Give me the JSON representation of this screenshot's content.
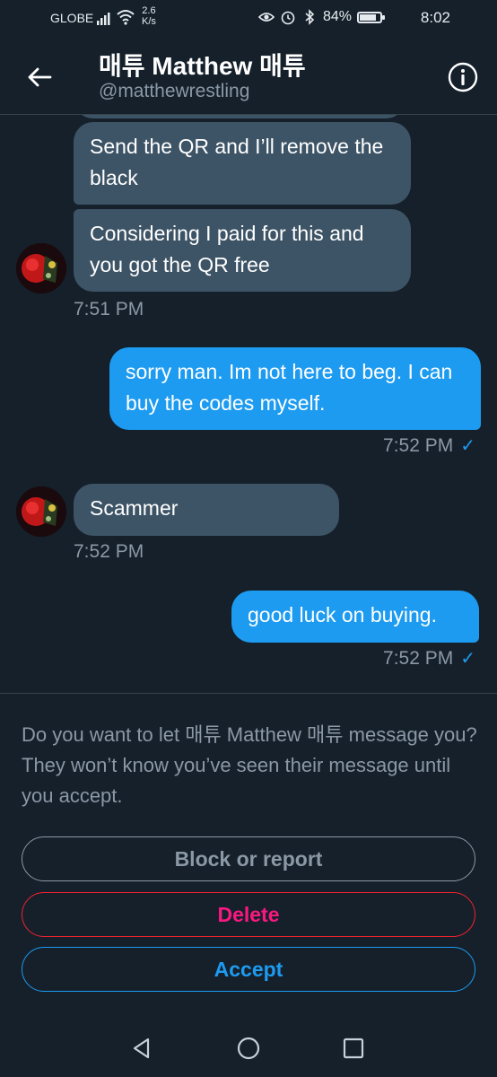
{
  "status_bar": {
    "carrier": "GLOBE",
    "net_speed_value": "2.6",
    "net_speed_unit": "K/s",
    "battery": "84%",
    "battery_level": 0.84,
    "time": "8:02"
  },
  "header": {
    "title": "매튜 Matthew 매튜",
    "handle": "@matthewrestling"
  },
  "messages": [
    {
      "direction": "received",
      "text": "Send the QR and I’ll remove the black"
    },
    {
      "direction": "received",
      "text": "Considering I paid for this and you got the QR free"
    },
    {
      "direction": "received_timestamp",
      "time": "7:51 PM"
    },
    {
      "direction": "sent",
      "text": "sorry man. Im not here to beg. I can buy the codes myself.",
      "time": "7:52 PM"
    },
    {
      "direction": "received",
      "text": "Scammer",
      "time": "7:52 PM"
    },
    {
      "direction": "sent",
      "text": "good luck on buying.",
      "time": "7:52 PM"
    }
  ],
  "request": {
    "prompt": "Do you want to let 매튜 Matthew 매튜 message you? They won’t know you’ve seen their message until you accept.",
    "block_label": "Block or report",
    "delete_label": "Delete",
    "accept_label": "Accept"
  },
  "colors": {
    "background": "#15202b",
    "accent": "#1d9bf0",
    "received_bubble": "#3d5466",
    "danger": "#f91880",
    "muted": "#8b98a5"
  },
  "icons": {
    "back": "arrow-left-icon",
    "info": "info-icon",
    "read_receipt": "checkmark-icon",
    "nav_back": "triangle-back-icon",
    "nav_home": "circle-home-icon",
    "nav_recents": "square-recents-icon"
  }
}
